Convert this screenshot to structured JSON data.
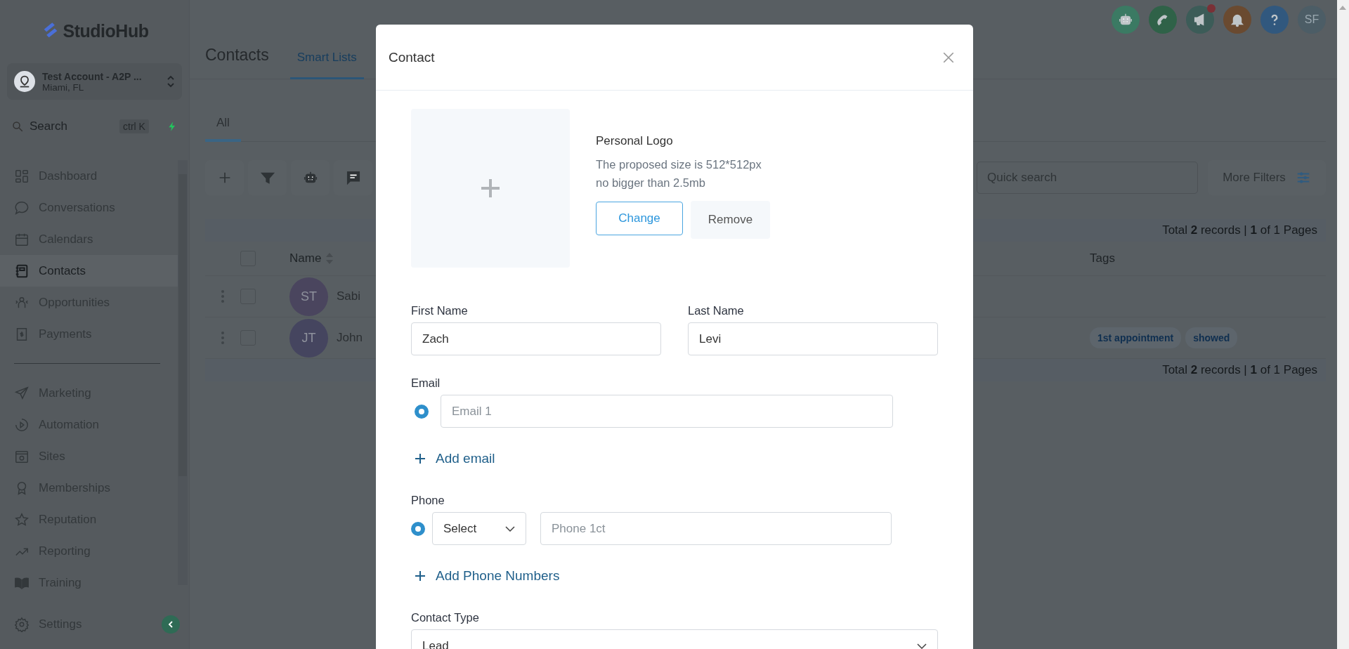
{
  "sidebar": {
    "logo": "StudioHub",
    "account": {
      "name": "Test Account - A2P ...",
      "location": "Miami, FL"
    },
    "search": {
      "placeholder": "Search",
      "shortcut": "ctrl K"
    },
    "nav_groups": [
      [
        {
          "label": "Dashboard",
          "kind": "grid",
          "selected": false
        },
        {
          "label": "Conversations",
          "kind": "chat",
          "selected": false
        },
        {
          "label": "Calendars",
          "kind": "calendar",
          "selected": false
        },
        {
          "label": "Contacts",
          "kind": "notebook",
          "selected": true
        },
        {
          "label": "Opportunities",
          "kind": "people",
          "selected": false
        },
        {
          "label": "Payments",
          "kind": "receipt",
          "selected": false
        }
      ],
      [
        {
          "label": "Marketing",
          "kind": "plane",
          "selected": false
        },
        {
          "label": "Automation",
          "kind": "play",
          "selected": false
        },
        {
          "label": "Sites",
          "kind": "browser",
          "selected": false
        },
        {
          "label": "Memberships",
          "kind": "award",
          "selected": false
        },
        {
          "label": "Reputation",
          "kind": "star",
          "selected": false
        },
        {
          "label": "Reporting",
          "kind": "trend",
          "selected": false
        },
        {
          "label": "Training",
          "kind": "book",
          "selected": false
        }
      ]
    ],
    "footer": {
      "label": "Settings",
      "kind": "gear"
    }
  },
  "header": {
    "title": "Contacts",
    "tabs": [
      {
        "label": "Smart Lists",
        "selected": true
      }
    ],
    "quick_actions": [
      {
        "kind": "robot",
        "color": "#3b7a63",
        "notification": false
      },
      {
        "kind": "phone",
        "color": "#2f6248",
        "notification": false
      },
      {
        "kind": "megaphone",
        "color": "#3c5c58",
        "notification": true
      },
      {
        "kind": "bell",
        "color": "#6a4a30",
        "notification": false
      },
      {
        "kind": "help",
        "color": "#31587e",
        "notification": false
      }
    ],
    "avatar": {
      "initials": "SF",
      "color": "#4c5d66"
    }
  },
  "list_tabs": [
    {
      "label": "All",
      "selected": true
    }
  ],
  "toolbar": {
    "buttons": [
      {
        "kind": "plus"
      },
      {
        "kind": "filter"
      },
      {
        "kind": "robot"
      },
      {
        "kind": "message"
      }
    ],
    "quick_search": {
      "placeholder": "Quick search"
    },
    "more_filters": "More Filters"
  },
  "table": {
    "summary_top": "Total **2** records | **1** of 1 Pages",
    "columns": [
      "Name",
      "Tags"
    ],
    "all_checked": false,
    "rows": [
      {
        "initials": "ST",
        "color": "#4a455e",
        "name": "Sabi",
        "checked": false,
        "tags": []
      },
      {
        "initials": "JT",
        "color": "#45455f",
        "name": "John",
        "checked": false,
        "tags": [
          "1st appointment",
          "showed"
        ]
      }
    ],
    "summary_bottom": "Total **2** records | **1** of 1 Pages"
  },
  "modal": {
    "title": "Contact",
    "logo": {
      "title": "Personal Logo",
      "hint_lines": [
        "The proposed size is 512*512px",
        "no bigger than 2.5mb"
      ],
      "change": "Change",
      "remove": "Remove"
    },
    "first_name": {
      "label": "First Name",
      "value": "Zach"
    },
    "last_name": {
      "label": "Last Name",
      "value": "Levi"
    },
    "email": {
      "label": "Email",
      "entries": [
        {
          "placeholder": "Email 1",
          "selected": true
        }
      ],
      "add": "Add email"
    },
    "phone": {
      "label": "Phone",
      "entries": [
        {
          "type": "Select",
          "placeholder": "Phone 1ct",
          "selected": true
        }
      ],
      "add": "Add Phone Numbers"
    },
    "contact_type": {
      "label": "Contact Type",
      "value": "Lead"
    }
  }
}
